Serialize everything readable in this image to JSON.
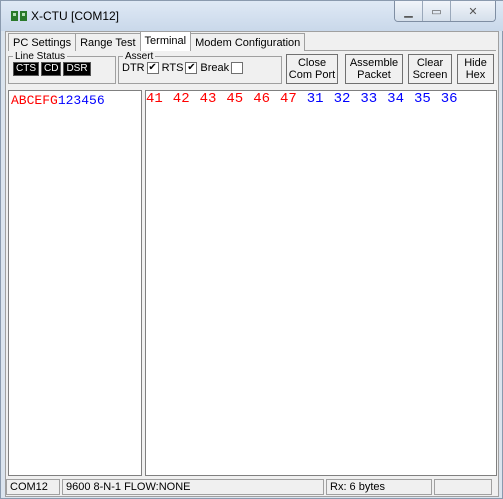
{
  "window": {
    "title": "X-CTU  [COM12]"
  },
  "tabs": [
    {
      "label": "PC Settings"
    },
    {
      "label": "Range Test"
    },
    {
      "label": "Terminal"
    },
    {
      "label": "Modem Configuration"
    }
  ],
  "line_status": {
    "legend": "Line Status",
    "leds": [
      "CTS",
      "CD",
      "DSR"
    ]
  },
  "assert": {
    "legend": "Assert",
    "items": [
      {
        "label": "DTR",
        "checked": true
      },
      {
        "label": "RTS",
        "checked": true
      },
      {
        "label": "Break",
        "checked": false
      }
    ]
  },
  "buttons": {
    "close_com_port": [
      "Close",
      "Com Port"
    ],
    "assemble_packet": [
      "Assemble",
      "Packet"
    ],
    "clear_screen": [
      "Clear",
      "Screen"
    ],
    "hide_hex": [
      "Hide",
      "Hex"
    ]
  },
  "terminal": {
    "ascii_red": "ABCEFG",
    "ascii_blue": "123456",
    "hex_red": [
      "41",
      "42",
      "43",
      "45",
      "46",
      "47"
    ],
    "hex_blue": [
      "31",
      "32",
      "33",
      "34",
      "35",
      "36"
    ]
  },
  "status": {
    "port": "COM12",
    "settings": "9600 8-N-1  FLOW:NONE",
    "rx": "Rx: 6 bytes"
  },
  "colors": {
    "sent": "#ff0000",
    "received": "#0000ff"
  }
}
